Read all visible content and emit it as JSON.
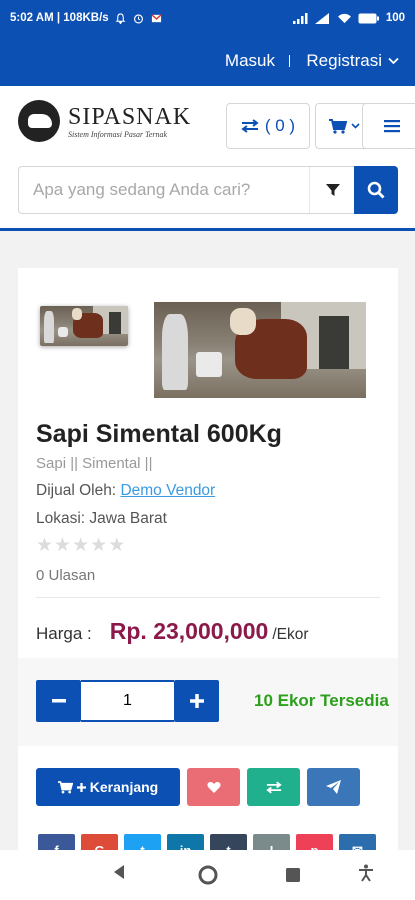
{
  "status_bar": {
    "time_speed": "5:02 AM | 108KB/s",
    "battery": "100"
  },
  "topnav": {
    "login": "Masuk",
    "register": "Registrasi"
  },
  "header": {
    "logo_name": "SIPASNAK",
    "logo_tagline": "Sistem Informasi Pasar Ternak",
    "compare_count": "( 0 )"
  },
  "search": {
    "placeholder": "Apa yang sedang Anda cari?"
  },
  "product": {
    "title": "Sapi Simental 600Kg",
    "category": "Sapi || Simental ||",
    "seller_label": "Dijual Oleh:",
    "seller_name": "Demo Vendor",
    "location": "Lokasi: Jawa Barat",
    "rating": 0,
    "rating_max": 5,
    "reviews": "0 Ulasan",
    "price_label": "Harga :",
    "price_value": "Rp. 23,000,000",
    "price_unit": "/Ekor",
    "quantity": "1",
    "stock": "10 Ekor Tersedia",
    "add_to_cart": "Keranjang"
  },
  "social": {
    "colors": [
      "#3b5998",
      "#dd4b39",
      "#1da1f2",
      "#0e76a8",
      "#35465c",
      "#7b8a8b",
      "#ee4056",
      "#2b6dad",
      "#0088cc"
    ]
  },
  "colors": {
    "brand": "#0d50b4",
    "price": "#8b1a4a",
    "stock": "#2ca01c"
  }
}
